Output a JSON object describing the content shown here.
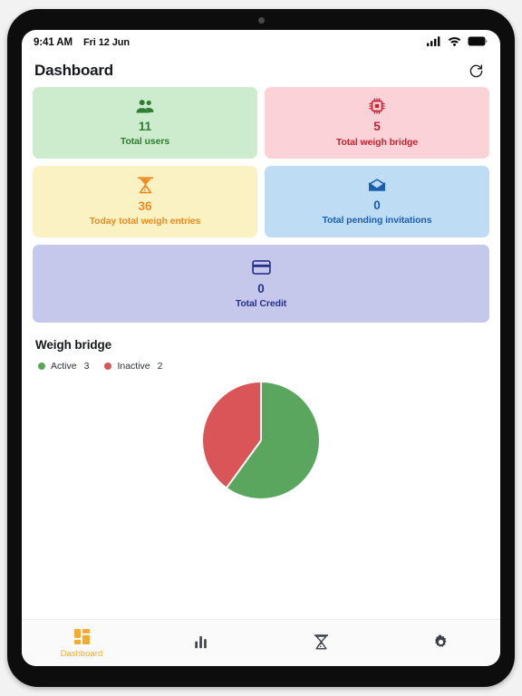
{
  "status_bar": {
    "time": "9:41 AM",
    "date": "Fri 12 Jun",
    "signal_icon": "cellular-signal-icon",
    "wifi_icon": "wifi-icon",
    "battery_icon": "battery-full-icon"
  },
  "app_bar": {
    "title": "Dashboard",
    "refresh_icon": "refresh-icon"
  },
  "cards": [
    {
      "value": "11",
      "label": "Total users",
      "icon": "group-users-icon",
      "bg": "#cdeccd",
      "fg": "#2e7d32",
      "size": "half"
    },
    {
      "value": "5",
      "label": "Total weigh bridge",
      "icon": "chip-cpu-icon",
      "bg": "#fbd2d7",
      "fg": "#c62331",
      "size": "half"
    },
    {
      "value": "36",
      "label": "Today total weigh entries",
      "icon": "weigh-scale-icon",
      "bg": "#fbf2c4",
      "fg": "#ef8b22",
      "size": "half"
    },
    {
      "value": "0",
      "label": "Total pending invitations",
      "icon": "envelope-icon",
      "bg": "#bfdcf5",
      "fg": "#1a5eae",
      "size": "half"
    },
    {
      "value": "0",
      "label": "Total Credit",
      "icon": "credit-card-icon",
      "bg": "#c5c8ea",
      "fg": "#27318c",
      "size": "full"
    }
  ],
  "chart_section": {
    "title": "Weigh bridge"
  },
  "chart_data": {
    "type": "pie",
    "title": "Weigh bridge",
    "categories": [
      "Active",
      "Inactive"
    ],
    "values": [
      3,
      2
    ],
    "colors": [
      "#5ba65f",
      "#d95557"
    ],
    "legend_position": "top-left",
    "total": 5
  },
  "bottom_nav": {
    "items": [
      {
        "label": "Dashboard",
        "icon": "dashboard-grid-icon",
        "active": true
      },
      {
        "label": "",
        "icon": "bar-chart-icon",
        "active": false
      },
      {
        "label": "",
        "icon": "weigh-scale-icon",
        "active": false
      },
      {
        "label": "",
        "icon": "gear-settings-icon",
        "active": false
      }
    ],
    "active_color": "#f4ab32",
    "inactive_color": "#3b3f46"
  }
}
